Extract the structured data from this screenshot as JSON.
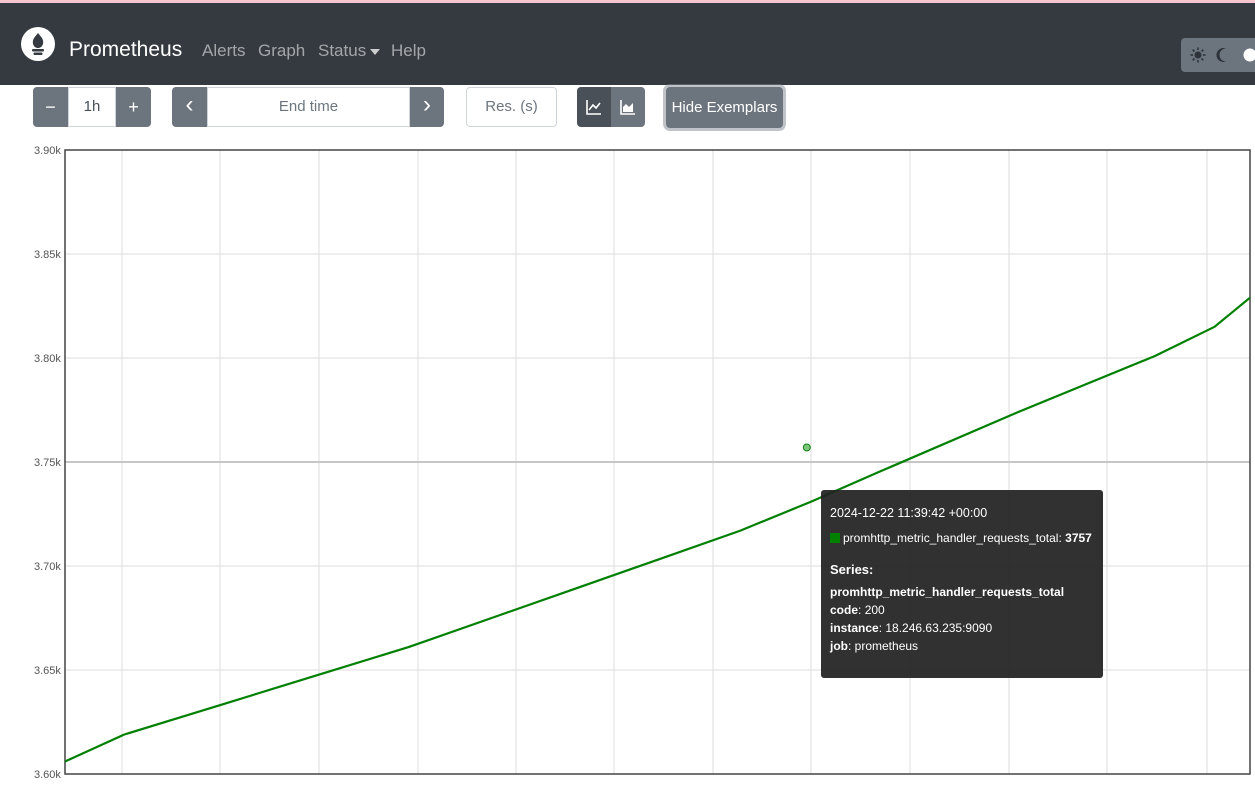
{
  "navbar": {
    "brand": "Prometheus",
    "links": [
      "Alerts",
      "Graph",
      "Status",
      "Help"
    ]
  },
  "controls": {
    "decrease_label": "−",
    "range_value": "1h",
    "increase_label": "+",
    "prev_label": "‹",
    "end_time_placeholder": "End time",
    "next_label": "›",
    "resolution_placeholder": "Res. (s)",
    "exemplar_button": "Hide Exemplars"
  },
  "theme_icons": [
    "sun-icon",
    "moon-icon",
    "circle-icon"
  ],
  "chart_data": {
    "type": "line",
    "y_ticks": [
      "3.90k",
      "3.85k",
      "3.80k",
      "3.75k",
      "3.70k",
      "3.65k",
      "3.60k"
    ],
    "ylim": [
      3600,
      3900
    ],
    "grid": true,
    "series": [
      {
        "color": "#008000",
        "x_frac": [
          0.0,
          0.05,
          0.13,
          0.21,
          0.29,
          0.36,
          0.43,
          0.5,
          0.57,
          0.63,
          0.686,
          0.8,
          0.86,
          0.92,
          0.97,
          1.0
        ],
        "values": [
          3606,
          3619,
          3633,
          3647,
          3661,
          3675,
          3689,
          3703,
          3717,
          3731,
          3745,
          3773,
          3787,
          3801,
          3815,
          3829
        ]
      }
    ],
    "highlight": {
      "x_frac": 0.626,
      "value": 3757
    }
  },
  "tooltip": {
    "datetime": "2024-12-22 11:39:42 +00:00",
    "metric_name": "promhttp_metric_handler_requests_total",
    "metric_value": "3757",
    "series_heading": "Series:",
    "series_name": "promhttp_metric_handler_requests_total",
    "labels": [
      {
        "key": "code",
        "value": "200"
      },
      {
        "key": "instance",
        "value": "18.246.63.235:9090"
      },
      {
        "key": "job",
        "value": "prometheus"
      }
    ]
  }
}
